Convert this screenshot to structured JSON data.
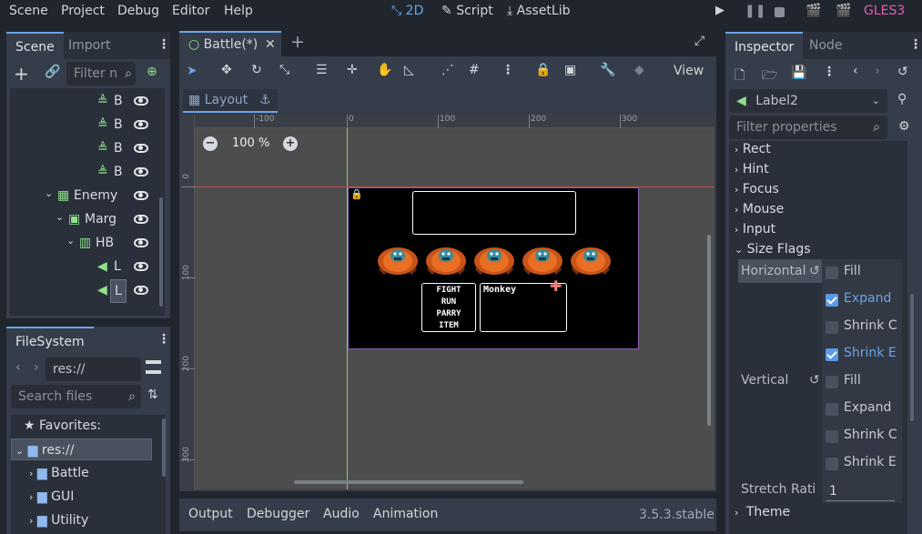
{
  "menu": {
    "scene": "Scene",
    "project": "Project",
    "debug": "Debug",
    "editor": "Editor",
    "help": "Help"
  },
  "workspaces": {
    "w2d": "2D",
    "script": "Script",
    "assetlib": "AssetLib"
  },
  "renderer": "GLES3",
  "scene_dock": {
    "tabs": [
      "Scene",
      "Import"
    ],
    "filter_placeholder": "Filter n",
    "tree": [
      {
        "label": "B",
        "type": "sprite"
      },
      {
        "label": "B",
        "type": "sprite"
      },
      {
        "label": "B",
        "type": "sprite"
      },
      {
        "label": "B",
        "type": "sprite"
      },
      {
        "label": "Enemy",
        "type": "grid"
      },
      {
        "label": "Marg",
        "type": "margin"
      },
      {
        "label": "HB",
        "type": "hbox"
      },
      {
        "label": "L",
        "type": "label"
      },
      {
        "label": "L",
        "type": "label"
      }
    ]
  },
  "filesystem": {
    "title": "FileSystem",
    "path": "res://",
    "search_placeholder": "Search files",
    "favorites": "Favorites:",
    "root": "res://",
    "folders": [
      "Battle",
      "GUI",
      "Utility"
    ]
  },
  "editor_tab": {
    "title": "Battle(*)"
  },
  "toolbar": {
    "view": "View"
  },
  "layout_btn": "Layout",
  "zoom": "100 %",
  "ruler_h": [
    "-100",
    "0",
    "100",
    "200",
    "300"
  ],
  "ruler_v": [
    "0",
    "100",
    "200",
    "300"
  ],
  "game": {
    "menu_items": [
      "FIGHT",
      "RUN",
      "PARRY",
      "ITEM"
    ],
    "target_label": "Monkey",
    "enemy_count": 5
  },
  "bottom": {
    "tabs": [
      "Output",
      "Debugger",
      "Audio",
      "Animation"
    ],
    "version": "3.5.3.stable"
  },
  "inspector": {
    "tabs": [
      "Inspector",
      "Node"
    ],
    "node_name": "Label2",
    "filter_placeholder": "Filter properties",
    "sections": [
      "Rect",
      "Hint",
      "Focus",
      "Mouse",
      "Input",
      "Size Flags"
    ],
    "horizontal_label": "Horizontal",
    "vertical_label": "Vertical",
    "horizontal_flags": [
      {
        "label": "Fill",
        "checked": false
      },
      {
        "label": "Expand",
        "checked": true
      },
      {
        "label": "Shrink C",
        "checked": false
      },
      {
        "label": "Shrink E",
        "checked": true
      }
    ],
    "vertical_flags": [
      {
        "label": "Fill",
        "checked": false
      },
      {
        "label": "Expand",
        "checked": false
      },
      {
        "label": "Shrink C",
        "checked": false
      },
      {
        "label": "Shrink E",
        "checked": false
      }
    ],
    "stretch_label": "Stretch Rati",
    "stretch_value": "1",
    "theme": "Theme"
  },
  "colors": {
    "accent": "#6aa4e8",
    "bg": "#20252e",
    "panel": "#363d4a",
    "viewport": "#4d4d4d",
    "check": "#5a9ae6",
    "renderer": "#e05fae"
  }
}
